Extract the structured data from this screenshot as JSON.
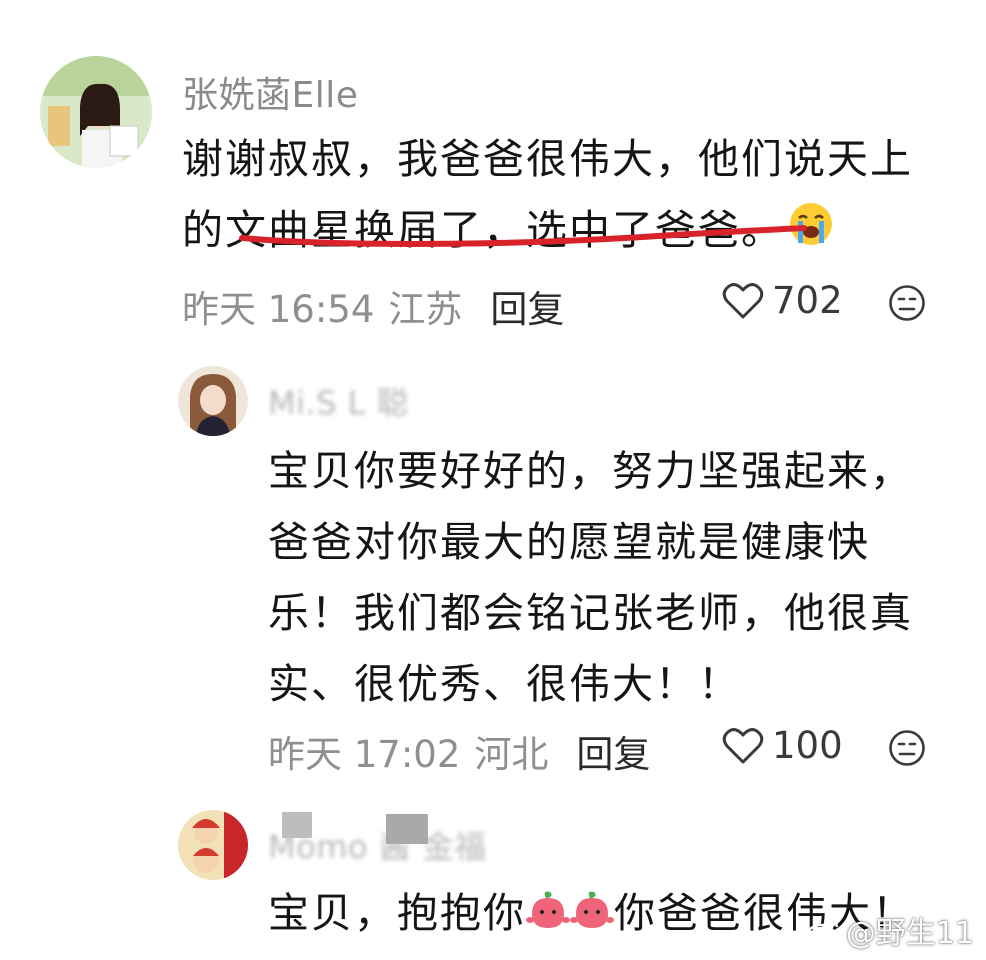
{
  "comments": [
    {
      "username": "张姺菡Elle",
      "lines": [
        "谢谢叔叔，我爸爸很伟大，他们说天上",
        "的文曲星换届了，选中了爸爸。"
      ],
      "emoji": "loudly-crying-face",
      "time": "昨天 16:54",
      "location": "江苏",
      "reply_label": "回复",
      "likes": "702"
    },
    {
      "username": "Mi.S L 聪",
      "lines": [
        "宝贝你要好好的，努力坚强起来，",
        "爸爸对你最大的愿望就是健康快",
        "乐！我们都会铭记张老师，他很真",
        "实、很优秀、很伟大！！"
      ],
      "time": "昨天 17:02",
      "location": "河北",
      "reply_label": "回复",
      "likes": "100"
    },
    {
      "username": "Momo 酱 金福",
      "line_parts": [
        "宝贝，抱抱你",
        "你爸爸很伟大！"
      ],
      "emoji": "hugging-peach-emoji"
    }
  ],
  "watermark": {
    "text": "@野生11",
    "icon": "weibo-logo-icon"
  },
  "colors": {
    "underline": "#d8232a",
    "meta": "#8f8f8f",
    "username": "#8a8a8a"
  }
}
